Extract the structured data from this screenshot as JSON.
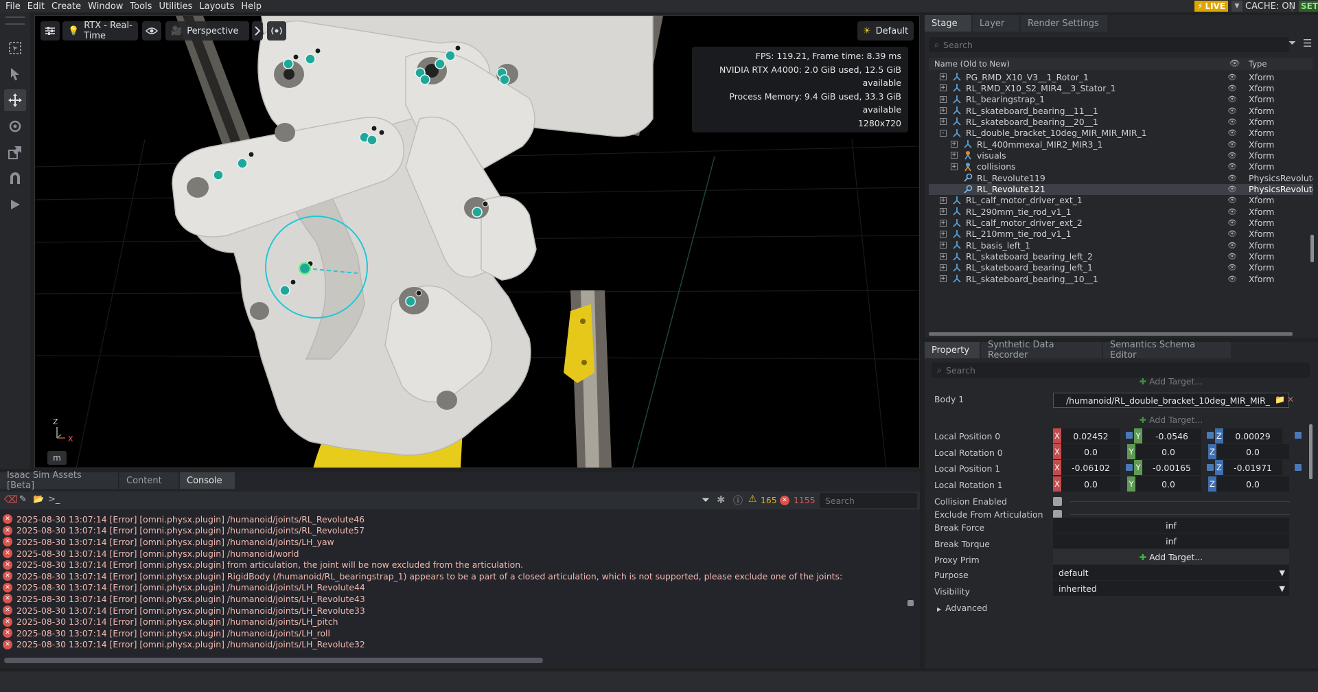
{
  "menubar": {
    "items": [
      "File",
      "Edit",
      "Create",
      "Window",
      "Tools",
      "Utilities",
      "Layouts",
      "Help"
    ],
    "live_label": "LIVE",
    "cache_label": "CACHE: ON",
    "set_label": "SET"
  },
  "left_toolbar": {
    "tools": [
      "select-box-icon",
      "select-arrow-icon",
      "move-icon",
      "rotate-icon",
      "scale-icon",
      "snap-icon",
      "play-icon"
    ]
  },
  "viewport": {
    "renderer_label": "RTX - Real-Time",
    "camera_label": "Perspective",
    "lighting_label": "Default",
    "stats": {
      "fps": "FPS: 119.21, Frame time: 8.39 ms",
      "gpu": "NVIDIA RTX A4000: 2.0 GiB used, 12.5 GiB available",
      "memory": "Process Memory: 9.4 GiB used, 33.3 GiB available",
      "resolution": "1280x720"
    },
    "gizmo": {
      "z": "Z",
      "x": "X"
    },
    "m_key": "m"
  },
  "bottom_panel": {
    "tabs": [
      "Isaac Sim Assets [Beta]",
      "Content",
      "Console"
    ],
    "active_tab": "Console",
    "warning_count": "165",
    "error_count": "1155",
    "search_placeholder": "Search",
    "log_lines": [
      "2025-08-30 13:07:14  [Error] [omni.physx.plugin] /humanoid/joints/RL_Revolute46",
      "2025-08-30 13:07:14  [Error] [omni.physx.plugin] /humanoid/joints/RL_Revolute57",
      "2025-08-30 13:07:14  [Error] [omni.physx.plugin] /humanoid/joints/LH_yaw",
      "2025-08-30 13:07:14  [Error] [omni.physx.plugin] /humanoid/world",
      "2025-08-30 13:07:14  [Error] [omni.physx.plugin]  from articulation, the joint will be now excluded from the articulation.",
      "2025-08-30 13:07:14  [Error] [omni.physx.plugin] RigidBody (/humanoid/RL_bearingstrap_1) appears to be a part of a closed articulation, which is not supported, please exclude one of the joints:",
      "2025-08-30 13:07:14  [Error] [omni.physx.plugin] /humanoid/joints/LH_Revolute44",
      "2025-08-30 13:07:14  [Error] [omni.physx.plugin] /humanoid/joints/LH_Revolute43",
      "2025-08-30 13:07:14  [Error] [omni.physx.plugin] /humanoid/joints/LH_Revolute33",
      "2025-08-30 13:07:14  [Error] [omni.physx.plugin] /humanoid/joints/LH_pitch",
      "2025-08-30 13:07:14  [Error] [omni.physx.plugin] /humanoid/joints/LH_roll",
      "2025-08-30 13:07:14  [Error] [omni.physx.plugin] /humanoid/joints/LH_Revolute32"
    ]
  },
  "stage": {
    "tabs": [
      "Stage",
      "Layer",
      "Render Settings"
    ],
    "active_tab": "Stage",
    "search_placeholder": "Search",
    "column_name": "Name (Old to New)",
    "column_type": "Type",
    "rows": [
      {
        "name": "PG_RMD_X10_V3__1_Rotor_1",
        "type": "Xform",
        "level": 0,
        "expander": "+",
        "icon": "xform-icon"
      },
      {
        "name": "RL_RMD_X10_S2_MIR4__3_Stator_1",
        "type": "Xform",
        "level": 0,
        "expander": "+",
        "icon": "xform-icon"
      },
      {
        "name": "RL_bearingstrap_1",
        "type": "Xform",
        "level": 0,
        "expander": "+",
        "icon": "xform-icon"
      },
      {
        "name": "RL_skateboard_bearing__11__1",
        "type": "Xform",
        "level": 0,
        "expander": "+",
        "icon": "xform-icon"
      },
      {
        "name": "RL_skateboard_bearing__20__1",
        "type": "Xform",
        "level": 0,
        "expander": "+",
        "icon": "xform-icon"
      },
      {
        "name": "RL_double_bracket_10deg_MIR_MIR_MIR_1",
        "type": "Xform",
        "level": 0,
        "expander": "-",
        "icon": "xform-icon"
      },
      {
        "name": "RL_400mmexal_MIR2_MIR3_1",
        "type": "Xform",
        "level": 1,
        "expander": "+",
        "icon": "xform-icon"
      },
      {
        "name": "visuals",
        "type": "Xform",
        "level": 1,
        "expander": "+",
        "icon": "visuals-icon"
      },
      {
        "name": "collisions",
        "type": "Xform",
        "level": 1,
        "expander": "+",
        "icon": "collisions-icon"
      },
      {
        "name": "RL_Revolute119",
        "type": "PhysicsRevolute",
        "level": 1,
        "expander": "",
        "icon": "joint-icon"
      },
      {
        "name": "RL_Revolute121",
        "type": "PhysicsRevolute",
        "level": 1,
        "expander": "",
        "icon": "joint-icon",
        "selected": true
      },
      {
        "name": "RL_calf_motor_driver_ext_1",
        "type": "Xform",
        "level": 0,
        "expander": "+",
        "icon": "xform-icon"
      },
      {
        "name": "RL_290mm_tie_rod_v1_1",
        "type": "Xform",
        "level": 0,
        "expander": "+",
        "icon": "xform-icon"
      },
      {
        "name": "RL_calf_motor_driver_ext_2",
        "type": "Xform",
        "level": 0,
        "expander": "+",
        "icon": "xform-icon"
      },
      {
        "name": "RL_210mm_tie_rod_v1_1",
        "type": "Xform",
        "level": 0,
        "expander": "+",
        "icon": "xform-icon"
      },
      {
        "name": "RL_basis_left_1",
        "type": "Xform",
        "level": 0,
        "expander": "+",
        "icon": "xform-icon"
      },
      {
        "name": "RL_skateboard_bearing_left_2",
        "type": "Xform",
        "level": 0,
        "expander": "+",
        "icon": "xform-icon"
      },
      {
        "name": "RL_skateboard_bearing_left_1",
        "type": "Xform",
        "level": 0,
        "expander": "+",
        "icon": "xform-icon"
      },
      {
        "name": "RL_skateboard_bearing__10__1",
        "type": "Xform",
        "level": 0,
        "expander": "+",
        "icon": "xform-icon"
      }
    ]
  },
  "property": {
    "tabs": [
      "Property",
      "Synthetic Data Recorder",
      "Semantics Schema Editor"
    ],
    "active_tab": "Property",
    "search_placeholder": "Search",
    "add_target_ghost": "Add Target...",
    "body1_label": "Body 1",
    "body1_path": "/humanoid/RL_double_bracket_10deg_MIR_MIR_",
    "add_target_label": "Add Target...",
    "local_position_0": {
      "label": "Local Position 0",
      "x": "0.02452",
      "y": "-0.0546",
      "z": "0.00029"
    },
    "local_rotation_0": {
      "label": "Local Rotation 0",
      "x": "0.0",
      "y": "0.0",
      "z": "0.0"
    },
    "local_position_1": {
      "label": "Local Position 1",
      "x": "-0.06102",
      "y": "-0.00165",
      "z": "-0.01971"
    },
    "local_rotation_1": {
      "label": "Local Rotation 1",
      "x": "0.0",
      "y": "0.0",
      "z": "0.0"
    },
    "axis_labels": {
      "x": "X",
      "y": "Y",
      "z": "Z"
    },
    "collision_enabled_label": "Collision Enabled",
    "exclude_label": "Exclude From Articulation",
    "break_force_label": "Break Force",
    "break_force_value": "inf",
    "break_torque_label": "Break Torque",
    "break_torque_value": "inf",
    "proxy_prim_label": "Proxy Prim",
    "proxy_add_target": "Add Target...",
    "purpose_label": "Purpose",
    "purpose_value": "default",
    "visibility_label": "Visibility",
    "visibility_value": "inherited",
    "advanced_label": "Advanced"
  },
  "colors": {
    "accent_teal": "#1fa89a",
    "selection_ring": "#21c7d6",
    "live_badge": "#e0a400",
    "error_red": "#d9534f"
  }
}
